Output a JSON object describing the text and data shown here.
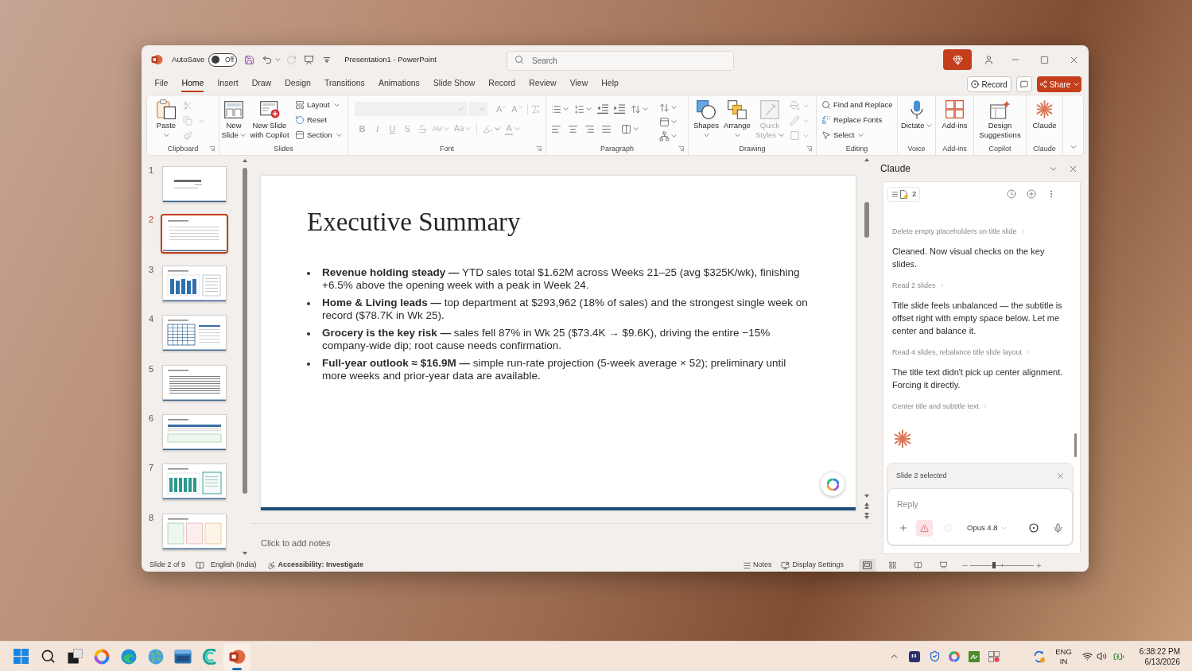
{
  "title_bar": {
    "autosave_label": "AutoSave",
    "autosave": {
      "on": false,
      "label": "Off"
    },
    "document_title": "Presentation1 - PowerPoint",
    "search": {
      "placeholder": "Search"
    }
  },
  "ribbon_tabs": [
    {
      "label": "File",
      "selected": false
    },
    {
      "label": "Home",
      "selected": true
    },
    {
      "label": "Insert",
      "selected": false
    },
    {
      "label": "Draw",
      "selected": false
    },
    {
      "label": "Design",
      "selected": false
    },
    {
      "label": "Transitions",
      "selected": false
    },
    {
      "label": "Animations",
      "selected": false
    },
    {
      "label": "Slide Show",
      "selected": false
    },
    {
      "label": "Record",
      "selected": false
    },
    {
      "label": "Review",
      "selected": false
    },
    {
      "label": "View",
      "selected": false
    },
    {
      "label": "Help",
      "selected": false
    }
  ],
  "ribbon_actions": {
    "record": "Record",
    "share": "Share"
  },
  "ribbon_groups": [
    {
      "kind": "clipboard",
      "label": "Clipboard",
      "launcher": true,
      "tools_disabled": true,
      "buttons": [
        {
          "label": "Paste",
          "dropdown": true,
          "disabled": false
        }
      ]
    },
    {
      "kind": "slides",
      "label": "Slides",
      "launcher": false,
      "buttons": [
        {
          "label": "New Slide",
          "dropdown": true,
          "disabled": false
        },
        {
          "label": "New Slide with Copilot",
          "dropdown": false,
          "disabled": false
        }
      ],
      "commands": [
        {
          "label": "Layout",
          "dropdown": true,
          "disabled": false
        },
        {
          "label": "Reset",
          "dropdown": false,
          "disabled": false
        },
        {
          "label": "Section",
          "dropdown": true,
          "disabled": false
        }
      ]
    },
    {
      "kind": "font",
      "label": "Font",
      "launcher": true,
      "tools_disabled": true,
      "tools": [
        {
          "kind": "grow",
          "label": "A"
        },
        {
          "kind": "shrink",
          "label": "A"
        },
        {
          "kind": "bold",
          "label": "B"
        },
        {
          "kind": "italic",
          "label": "I"
        },
        {
          "kind": "underline",
          "label": "U"
        },
        {
          "kind": "shadow",
          "label": "S"
        },
        {
          "kind": "spacing",
          "label": "AV"
        },
        {
          "kind": "case",
          "label": "Aa"
        },
        {
          "kind": "color",
          "label": "A"
        }
      ]
    },
    {
      "kind": "paragraph",
      "label": "Paragraph",
      "launcher": true,
      "tools_disabled": false
    },
    {
      "kind": "drawing",
      "label": "Drawing",
      "launcher": true,
      "tools_disabled": true,
      "buttons": [
        {
          "label": "Shapes",
          "dropdown": true,
          "disabled": false
        },
        {
          "label": "Arrange",
          "dropdown": true,
          "disabled": false
        },
        {
          "label": "Quick Styles",
          "dropdown": true,
          "disabled": true
        }
      ]
    },
    {
      "kind": "editing",
      "label": "Editing",
      "launcher": false,
      "commands": [
        {
          "label": "Find and Replace",
          "dropdown": false,
          "disabled": false
        },
        {
          "label": "Replace Fonts",
          "dropdown": false,
          "disabled": false
        },
        {
          "label": "Select",
          "dropdown": true,
          "disabled": false
        }
      ]
    },
    {
      "kind": "voice",
      "label": "Voice",
      "launcher": false,
      "buttons": [
        {
          "label": "Dictate",
          "dropdown": true,
          "disabled": false
        }
      ]
    },
    {
      "kind": "addins",
      "label": "Add-ins",
      "launcher": false,
      "buttons": [
        {
          "label": "Add-ins",
          "dropdown": false,
          "disabled": false
        }
      ]
    },
    {
      "kind": "copilot",
      "label": "Copilot",
      "launcher": false,
      "buttons": [
        {
          "label": "Design Suggestions",
          "dropdown": false,
          "disabled": false
        }
      ]
    },
    {
      "kind": "claude",
      "label": "Claude",
      "launcher": false,
      "buttons": [
        {
          "label": "Claude",
          "dropdown": false,
          "disabled": false
        }
      ]
    }
  ],
  "thumbnails": [
    {
      "number": "1",
      "kind": "title",
      "selected": false
    },
    {
      "number": "2",
      "kind": "bullets",
      "selected": true
    },
    {
      "number": "3",
      "kind": "chart",
      "selected": false
    },
    {
      "number": "4",
      "kind": "table",
      "selected": false
    },
    {
      "number": "5",
      "kind": "lines",
      "selected": false
    },
    {
      "number": "6",
      "kind": "bands",
      "selected": false
    },
    {
      "number": "7",
      "kind": "columns",
      "selected": false
    },
    {
      "number": "8",
      "kind": "panels",
      "selected": false
    }
  ],
  "slide": {
    "title": "Executive Summary",
    "bullets": [
      "**Revenue holding steady —** YTD sales total $1.62M across Weeks 21–25 (avg $325K/wk), finishing +6.5% above the opening week with a peak in Week 24.",
      "**Home & Living leads —** top department at $293,962 (18% of sales) and the strongest single week on record ($78.7K in Wk 25).",
      "**Grocery is the key risk —** sales fell 87% in Wk 25 ($73.4K → $9.6K), driving the entire −15% company-wide dip; root cause needs confirmation.",
      "**Full-year outlook ≈ $16.9M —** simple run-rate projection (5-week average × 52); preliminary until more weeks and prior-year data are available."
    ]
  },
  "notes": {
    "placeholder": "Click to add notes"
  },
  "assistant_panel": {
    "title": "Claude",
    "context_count": "2",
    "feed": [
      {
        "kind": "step",
        "text": "Delete empty placeholders on title slide"
      },
      {
        "kind": "message",
        "text": "Cleaned. Now visual checks on the key slides."
      },
      {
        "kind": "step",
        "text": "Read 2 slides"
      },
      {
        "kind": "message",
        "text": "Title slide feels unbalanced — the subtitle is offset right with empty space below. Let me center and balance it."
      },
      {
        "kind": "step",
        "text": "Read 4 slides, rebalance title slide layout"
      },
      {
        "kind": "message",
        "text": "The title text didn't pick up center alignment. Forcing it directly."
      },
      {
        "kind": "step",
        "text": "Center title and subtitle text"
      }
    ],
    "thinking": true,
    "composer": {
      "context": "Slide 2 selected",
      "placeholder": "Reply",
      "model": "Opus 4.8"
    }
  },
  "status_bar": {
    "slide_position": "Slide 2 of 9",
    "language": "English (India)",
    "accessibility": "Accessibility: Investigate",
    "notes": "Notes",
    "display_settings": "Display Settings",
    "views": [
      {
        "selected": true
      },
      {
        "selected": false
      },
      {
        "selected": false
      },
      {
        "selected": false
      }
    ],
    "zoom": {
      "level": 0.38
    }
  },
  "taskbar": {
    "apps": [
      {
        "active": false
      },
      {
        "active": false
      },
      {
        "active": false
      },
      {
        "active": false
      },
      {
        "active": false
      },
      {
        "active": false
      },
      {
        "active": true
      }
    ],
    "tray": {
      "language": "ENG",
      "region": "IN",
      "time": "6:38:22 PM",
      "date": "6/13/2026"
    }
  }
}
